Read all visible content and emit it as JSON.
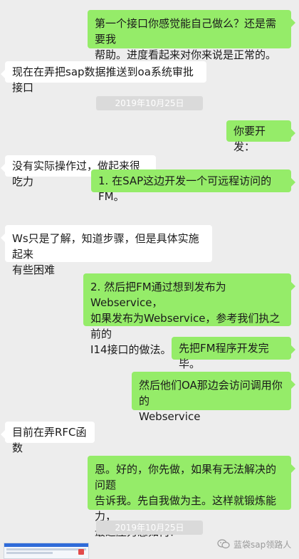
{
  "conversation": {
    "messages": [
      {
        "side": "right",
        "text": "第一个接口你感觉能自己做么？还是需要我\n帮助。进度看起来对你来说是正常的。"
      },
      {
        "side": "left",
        "text": "现在在弄把sap数据推送到oa系统审批接口"
      },
      {
        "side": "right",
        "text": "你要开发："
      },
      {
        "side": "left",
        "text": "没有实际操作过，做起来很吃力"
      },
      {
        "side": "right",
        "text": "1. 在SAP这边开发一个可远程访问的FM。"
      },
      {
        "side": "left",
        "text": "Ws只是了解，知道步骤，但是具体实施起来\n有些困难"
      },
      {
        "side": "right",
        "text": "2. 然后把FM通过想到发布为Webservice，\n如果发布为Webservice，参考我们执之前的\nI14接口的做法。"
      },
      {
        "side": "right",
        "text": "先把FM程序开发完毕。"
      },
      {
        "side": "right",
        "text": "然后他们OA那边会访问调用你的\nWebservice"
      },
      {
        "side": "left",
        "text": "目前在弄RFC函数"
      },
      {
        "side": "right",
        "text": "恩。好的，你先做，如果有无法解决的问题\n告诉我。先自我做为主。这样就锻炼能力，\n最近压力感如何？"
      }
    ],
    "timestamps": [
      "2019年10月25日",
      "2019年10月25日"
    ]
  },
  "watermark": {
    "icon": "wechat-icon",
    "text": "蓝袋sap领路人"
  },
  "colors": {
    "background": "#ededed",
    "bubble_self": "#95ec69",
    "bubble_other": "#ffffff"
  }
}
